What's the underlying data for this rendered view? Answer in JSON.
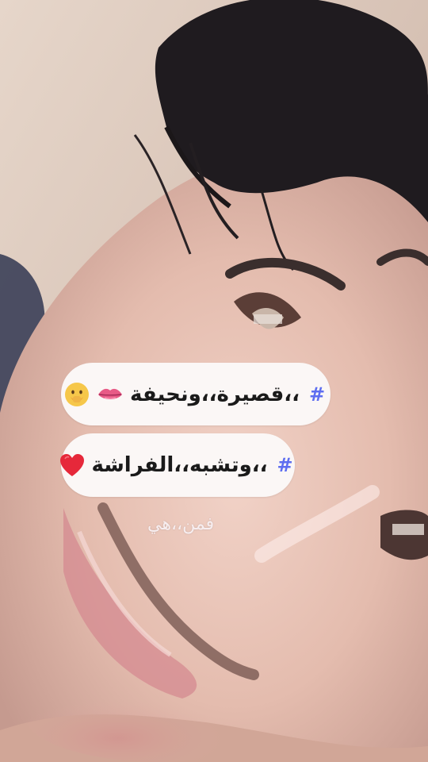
{
  "captions": [
    {
      "text": "،،قصيرة،،ونحيفة",
      "hashtag": "#"
    },
    {
      "text": "،،وتشبه،،الفراشة",
      "hashtag": "#"
    }
  ],
  "floating_text": "فمن،،هي",
  "colors": {
    "hashtag": "#5e6ef0",
    "pill_bg": "#fbf7f6",
    "heart": "#e6283a",
    "lips": "#e85a86"
  },
  "icons": {
    "caption1_emojis": [
      "lips-icon",
      "hand-over-mouth-face-icon"
    ],
    "caption2_emojis": [
      "red-heart-icon"
    ]
  }
}
